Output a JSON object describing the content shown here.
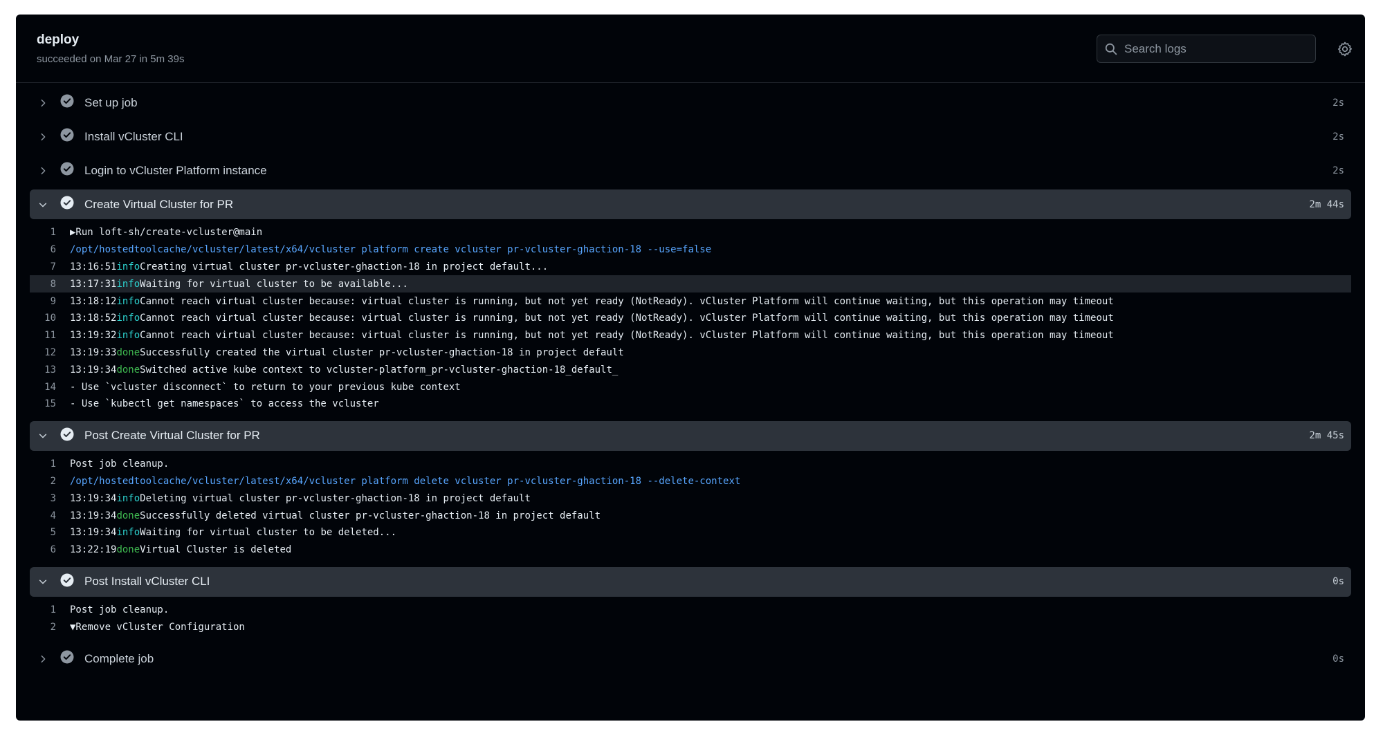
{
  "job": {
    "title": "deploy",
    "subtitle": "succeeded on Mar 27 in 5m 39s"
  },
  "search": {
    "placeholder": "Search logs"
  },
  "icons": {
    "search": "search-icon",
    "settings": "gear-icon",
    "success": "check-circle-icon",
    "expand": "chevron-right-icon",
    "collapse": "chevron-down-icon"
  },
  "colors": {
    "background": "#010409",
    "open_step": "#2d333b",
    "info": "#2dd3d0",
    "done": "#3fb950",
    "command": "#58a6ff"
  },
  "steps": [
    {
      "name": "Set up job",
      "time": "2s"
    },
    {
      "name": "Install vCluster CLI",
      "time": "2s"
    },
    {
      "name": "Login to vCluster Platform instance",
      "time": "2s"
    },
    {
      "name": "Create Virtual Cluster for PR",
      "time": "2m 44s",
      "lines": [
        {
          "n": "1",
          "text": "▶Run loft-sh/create-vcluster@main"
        },
        {
          "n": "6",
          "text": "/opt/hostedtoolcache/vcluster/latest/x64/vcluster platform create vcluster pr-vcluster-ghaction-18 --use=false"
        },
        {
          "n": "7",
          "time": "13:16:51",
          "level": "info",
          "text": "Creating virtual cluster pr-vcluster-ghaction-18 in project default..."
        },
        {
          "n": "8",
          "time": "13:17:31",
          "level": "info",
          "text": "Waiting for virtual cluster to be available..."
        },
        {
          "n": "9",
          "time": "13:18:12",
          "level": "info",
          "text": "Cannot reach virtual cluster because: virtual cluster is running, but not yet ready (NotReady). vCluster Platform will continue waiting, but this operation may timeout"
        },
        {
          "n": "10",
          "time": "13:18:52",
          "level": "info",
          "text": "Cannot reach virtual cluster because: virtual cluster is running, but not yet ready (NotReady). vCluster Platform will continue waiting, but this operation may timeout"
        },
        {
          "n": "11",
          "time": "13:19:32",
          "level": "info",
          "text": "Cannot reach virtual cluster because: virtual cluster is running, but not yet ready (NotReady). vCluster Platform will continue waiting, but this operation may timeout"
        },
        {
          "n": "12",
          "time": "13:19:33",
          "level": "done",
          "text": "Successfully created the virtual cluster pr-vcluster-ghaction-18 in project default"
        },
        {
          "n": "13",
          "time": "13:19:34",
          "level": "done",
          "text": "Switched active kube context to vcluster-platform_pr-vcluster-ghaction-18_default_"
        },
        {
          "n": "14",
          "text": "- Use `vcluster disconnect` to return to your previous kube context"
        },
        {
          "n": "15",
          "text": "- Use `kubectl get namespaces` to access the vcluster"
        }
      ]
    },
    {
      "name": "Post Create Virtual Cluster for PR",
      "time": "2m 45s",
      "lines": [
        {
          "n": "1",
          "text": "Post job cleanup."
        },
        {
          "n": "2",
          "text": "/opt/hostedtoolcache/vcluster/latest/x64/vcluster platform delete vcluster pr-vcluster-ghaction-18 --delete-context"
        },
        {
          "n": "3",
          "time": "13:19:34",
          "level": "info",
          "text": "Deleting virtual cluster pr-vcluster-ghaction-18 in project default"
        },
        {
          "n": "4",
          "time": "13:19:34",
          "level": "done",
          "text": "Successfully deleted virtual cluster pr-vcluster-ghaction-18 in project default"
        },
        {
          "n": "5",
          "time": "13:19:34",
          "level": "info",
          "text": "Waiting for virtual cluster to be deleted..."
        },
        {
          "n": "6",
          "time": "13:22:19",
          "level": "done",
          "text": "Virtual Cluster is deleted"
        }
      ]
    },
    {
      "name": "Post Install vCluster CLI",
      "time": "0s",
      "lines": [
        {
          "n": "1",
          "text": "Post job cleanup."
        },
        {
          "n": "2",
          "text": "▼Remove vCluster Configuration"
        }
      ]
    },
    {
      "name": "Complete job",
      "time": "0s"
    }
  ]
}
